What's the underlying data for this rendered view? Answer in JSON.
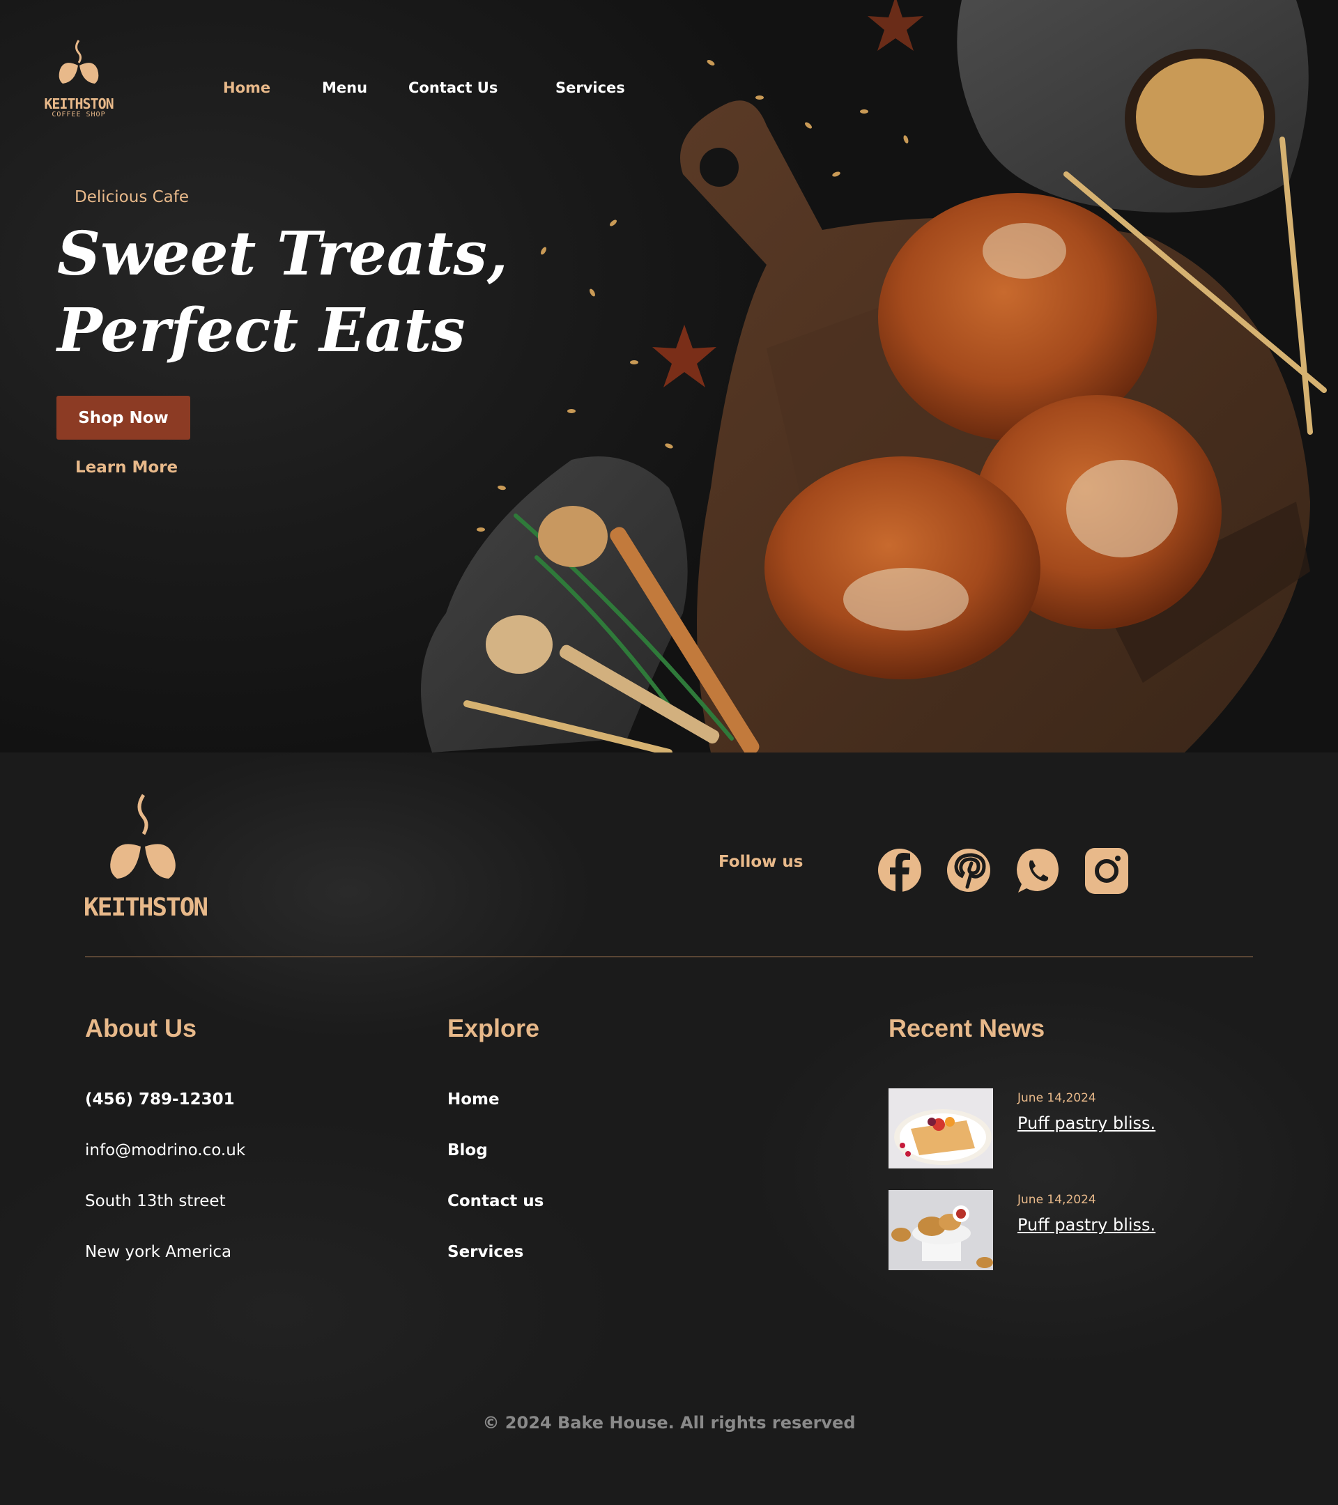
{
  "brand": {
    "name": "KEITHSTON",
    "tagline": "COFFEE SHOP",
    "accent": "#e8b98a",
    "button_color": "#8c3b24"
  },
  "nav": {
    "items": [
      {
        "label": "Home",
        "active": true
      },
      {
        "label": "Menu",
        "active": false
      },
      {
        "label": "Contact Us",
        "active": false
      },
      {
        "label": "Services",
        "active": false
      }
    ]
  },
  "hero": {
    "eyebrow": "Delicious Cafe",
    "headline_line1": "Sweet Treats,",
    "headline_line2": "Perfect Eats",
    "primary_button": "Shop Now",
    "secondary_link": "Learn More",
    "image_subject": "sweet buns on a wooden cutting board with wheat, star anise and honey dippers"
  },
  "footer": {
    "follow_label": "Follow us",
    "social_icons": [
      "facebook-icon",
      "pinterest-icon",
      "whatsapp-icon",
      "instagram-icon"
    ],
    "about": {
      "title": "About Us",
      "phone": "(456) 789-12301",
      "email": "info@modrino.co.uk",
      "street": "South 13th street",
      "city": "New york America"
    },
    "explore": {
      "title": "Explore",
      "links": [
        "Home",
        "Blog",
        "Contact us",
        "Services"
      ]
    },
    "news": {
      "title": "Recent News",
      "items": [
        {
          "date": "June 14,2024",
          "title": "Puff pastry bliss."
        },
        {
          "date": "June 14,2024",
          "title": "Puff pastry bliss."
        }
      ]
    },
    "copyright": "© 2024 Bake House. All rights reserved"
  }
}
